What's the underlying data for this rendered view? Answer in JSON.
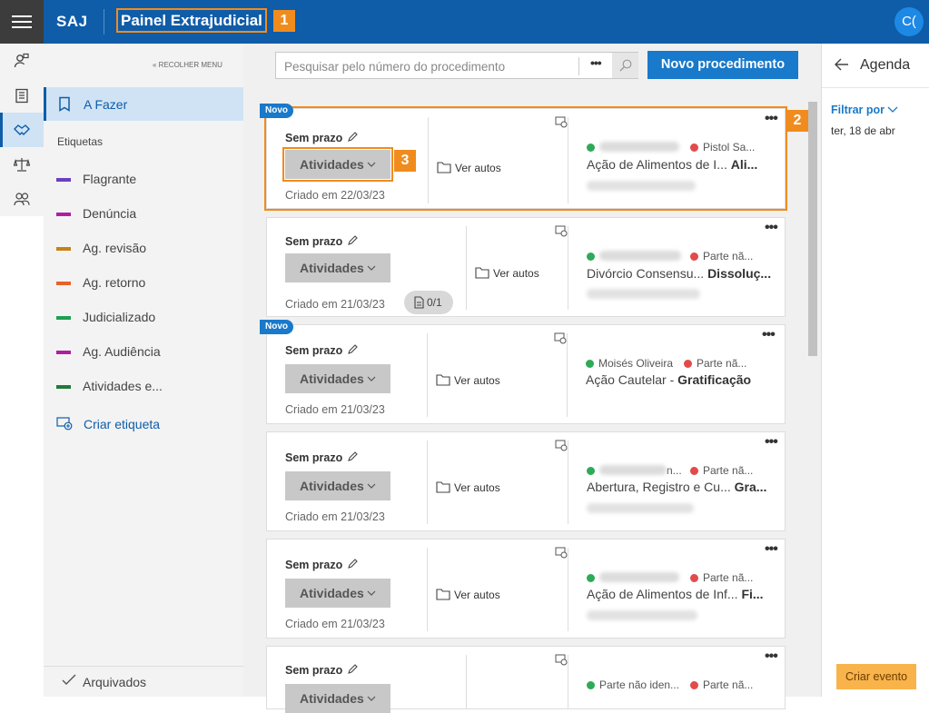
{
  "header": {
    "brand": "SAJ",
    "title": "Painel Extrajudicial",
    "avatar": "C(",
    "badges": [
      "1",
      "2",
      "3"
    ]
  },
  "rail": {
    "icons": [
      "person-pin-icon",
      "clipboard-icon",
      "handshake-icon",
      "scale-icon",
      "people-icon"
    ]
  },
  "sidebar": {
    "collapse": "RECOLHER MENU",
    "active": "A Fazer",
    "labels_title": "Etiquetas",
    "tags": [
      {
        "label": "Flagrante",
        "color": "#6a3fc1"
      },
      {
        "label": "Denúncia",
        "color": "#b01ea0"
      },
      {
        "label": "Ag. revisão",
        "color": "#c78215"
      },
      {
        "label": "Ag. retorno",
        "color": "#e8622a"
      },
      {
        "label": "Judicializado",
        "color": "#20a050"
      },
      {
        "label": "Ag. Audiência",
        "color": "#b01ea0"
      },
      {
        "label": "Atividades e...",
        "color": "#1f7a3a"
      }
    ],
    "create": "Criar etiqueta",
    "archived": "Arquivados"
  },
  "toolbar": {
    "search_placeholder": "Pesquisar pelo número do procedimento",
    "more": "•••",
    "new_button": "Novo procedimento"
  },
  "cards": [
    {
      "novo": "Novo",
      "prazo": "Sem prazo",
      "atividades": "Atividades",
      "criado": "Criado em 22/03/23",
      "ver_autos": "Ver autos",
      "party_a": "",
      "party_b": "Pistol Sa...",
      "acao": "Ação de Alimentos de I...",
      "acao_b": "Ali...",
      "more": "•••"
    },
    {
      "novo": "",
      "prazo": "Sem prazo",
      "atividades": "Atividades",
      "criado": "Criado em 21/03/23",
      "docs": "0/1",
      "ver_autos": "Ver autos",
      "party_a": "",
      "party_b": "Parte nã...",
      "acao": "Divórcio Consensu...",
      "acao_b": "Dissoluç...",
      "more": "•••"
    },
    {
      "novo": "Novo",
      "prazo": "Sem prazo",
      "atividades": "Atividades",
      "criado": "Criado em 21/03/23",
      "ver_autos": "Ver autos",
      "party_a": "Moisés Oliveira",
      "party_b": "Parte nã...",
      "acao": "Ação Cautelar - ",
      "acao_b": "Gratificação",
      "more": "•••"
    },
    {
      "novo": "",
      "prazo": "Sem prazo",
      "atividades": "Atividades",
      "criado": "Criado em 21/03/23",
      "ver_autos": "Ver autos",
      "party_a": "n...",
      "party_b": "Parte nã...",
      "acao": "Abertura, Registro e Cu...",
      "acao_b": "Gra...",
      "more": "•••"
    },
    {
      "novo": "",
      "prazo": "Sem prazo",
      "atividades": "Atividades",
      "criado": "Criado em 21/03/23",
      "ver_autos": "Ver autos",
      "party_a": "",
      "party_b": "Parte nã...",
      "acao": "Ação de Alimentos de Inf...",
      "acao_b": "Fi...",
      "more": "•••"
    },
    {
      "novo": "",
      "prazo": "Sem prazo",
      "atividades": "Atividades",
      "criado": "",
      "ver_autos": "",
      "party_a": "Parte não iden...",
      "party_b": "Parte nã...",
      "acao": "",
      "acao_b": "",
      "more": "•••"
    }
  ],
  "agenda": {
    "title": "Agenda",
    "filter": "Filtrar por",
    "date": "ter, 18 de abr",
    "create": "Criar evento"
  }
}
